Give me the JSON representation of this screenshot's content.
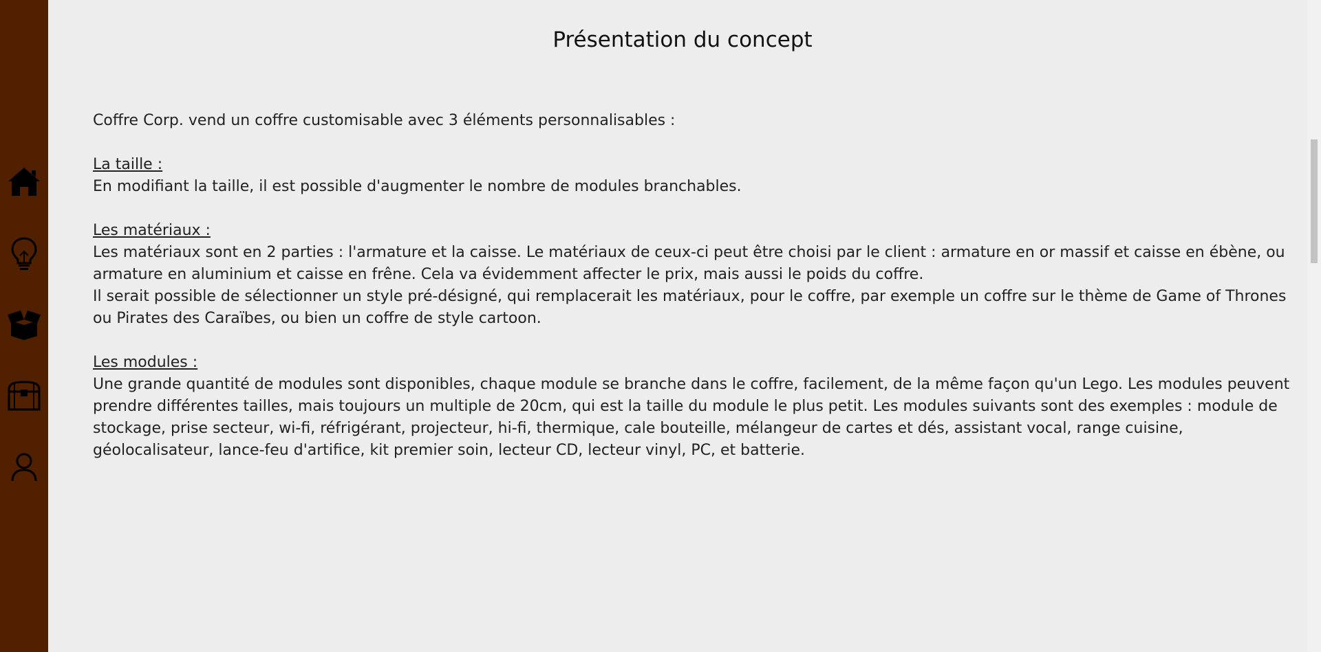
{
  "sidebar": {
    "background": "#512000",
    "icons": [
      {
        "name": "home-icon"
      },
      {
        "name": "lightbulb-icon"
      },
      {
        "name": "open-box-icon"
      },
      {
        "name": "treasure-chest-icon"
      },
      {
        "name": "user-icon"
      }
    ]
  },
  "main": {
    "title": "Présentation du concept",
    "intro": "Coffre Corp. vend un coffre customisable avec 3 éléments personnalisables :",
    "sections": [
      {
        "heading": "La taille :",
        "paragraphs": [
          "En modifiant la taille, il est possible d'augmenter le nombre de modules branchables."
        ]
      },
      {
        "heading": "Les matériaux :",
        "paragraphs": [
          "Les matériaux sont en 2 parties : l'armature et la caisse. Le matériaux de ceux-ci peut être choisi par le client : armature en or massif et caisse en ébène, ou armature en aluminium et caisse en frêne. Cela va évidemment affecter le prix, mais aussi le poids du coffre.",
          "Il serait possible de sélectionner un style pré-désigné, qui remplacerait les matériaux, pour le coffre, par exemple un coffre sur le thème de Game of Thrones ou Pirates des Caraïbes, ou bien un coffre de style cartoon."
        ]
      },
      {
        "heading": "Les modules :",
        "paragraphs": [
          "Une grande quantité de modules sont disponibles, chaque module se branche dans le coffre, facilement, de la même façon qu'un Lego. Les modules peuvent prendre différentes tailles, mais toujours un multiple de 20cm, qui est la taille du module le plus petit. Les modules suivants sont des exemples : module de stockage, prise secteur, wi-fi, réfrigérant, projecteur, hi-fi, thermique, cale bouteille, mélangeur de cartes et dés, assistant vocal, range cuisine, géolocalisateur, lance-feu d'artifice, kit premier soin, lecteur CD, lecteur vinyl, PC, et batterie."
        ]
      }
    ]
  }
}
